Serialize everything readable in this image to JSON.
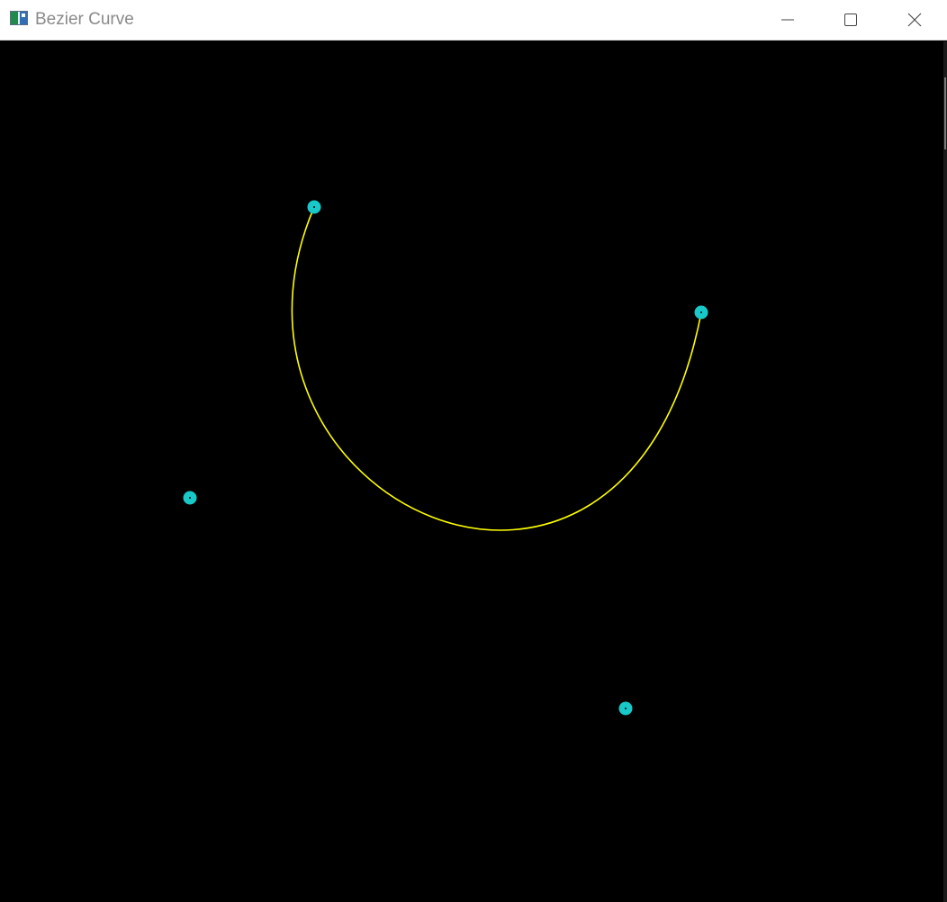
{
  "window": {
    "title": "Bezier Curve",
    "controls": {
      "minimize_icon": "minimize-icon",
      "maximize_icon": "maximize-icon",
      "close_icon": "close-icon"
    }
  },
  "colors": {
    "background": "#000000",
    "curve": "#ffff00",
    "control_point": "#19c8c8",
    "control_point_center": "#000000"
  }
}
